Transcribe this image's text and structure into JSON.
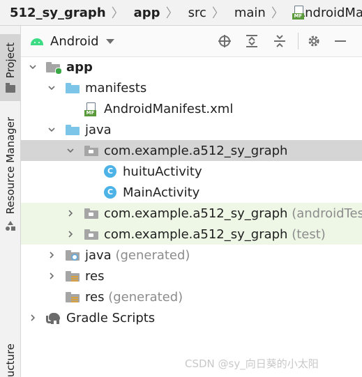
{
  "breadcrumb": [
    {
      "label": "512_sy_graph"
    },
    {
      "label": "app"
    },
    {
      "label": "src"
    },
    {
      "label": "main"
    },
    {
      "label": "AndroidManifest.x"
    }
  ],
  "side_tabs": {
    "project": "Project",
    "resource_manager": "Resource Manager",
    "structure": "ucture"
  },
  "panel": {
    "view_selector": "Android",
    "toolbar_icons": [
      "crosshair-icon",
      "expand-all-icon",
      "collapse-all-icon",
      "gear-icon",
      "minimize-icon"
    ]
  },
  "tree": [
    {
      "label": "app",
      "suffix": "",
      "expanded": true,
      "icon": "module-folder-icon"
    },
    {
      "label": "manifests",
      "suffix": "",
      "expanded": true,
      "icon": "folder-icon"
    },
    {
      "label": "AndroidManifest.xml",
      "suffix": "",
      "expanded": null,
      "icon": "manifest-file-icon"
    },
    {
      "label": "java",
      "suffix": "",
      "expanded": true,
      "icon": "folder-icon"
    },
    {
      "label": "com.example.a512_sy_graph",
      "suffix": "",
      "expanded": true,
      "icon": "package-icon",
      "selected": true
    },
    {
      "label": "huituActivity",
      "suffix": "",
      "expanded": null,
      "icon": "class-icon"
    },
    {
      "label": "MainActivity",
      "suffix": "",
      "expanded": null,
      "icon": "class-icon"
    },
    {
      "label": "com.example.a512_sy_graph",
      "suffix": " (androidTest)",
      "expanded": false,
      "icon": "package-icon",
      "highlighted": true
    },
    {
      "label": "com.example.a512_sy_graph",
      "suffix": " (test)",
      "expanded": false,
      "icon": "package-icon",
      "highlighted": true
    },
    {
      "label": "java",
      "suffix": " (generated)",
      "expanded": false,
      "icon": "generated-folder-icon"
    },
    {
      "label": "res",
      "suffix": "",
      "expanded": false,
      "icon": "res-folder-icon"
    },
    {
      "label": "res",
      "suffix": " (generated)",
      "expanded": null,
      "icon": "res-folder-icon"
    },
    {
      "label": "Gradle Scripts",
      "suffix": "",
      "expanded": false,
      "icon": "gradle-icon"
    }
  ],
  "watermark": "CSDN @sy_向日葵的小太阳",
  "colors": {
    "selected_row": "#d5d5d5",
    "test_row": "#eef7e6",
    "folder_blue": "#7cc5e8",
    "class_icon": "#4db3e6",
    "android_green": "#3ddc84"
  }
}
